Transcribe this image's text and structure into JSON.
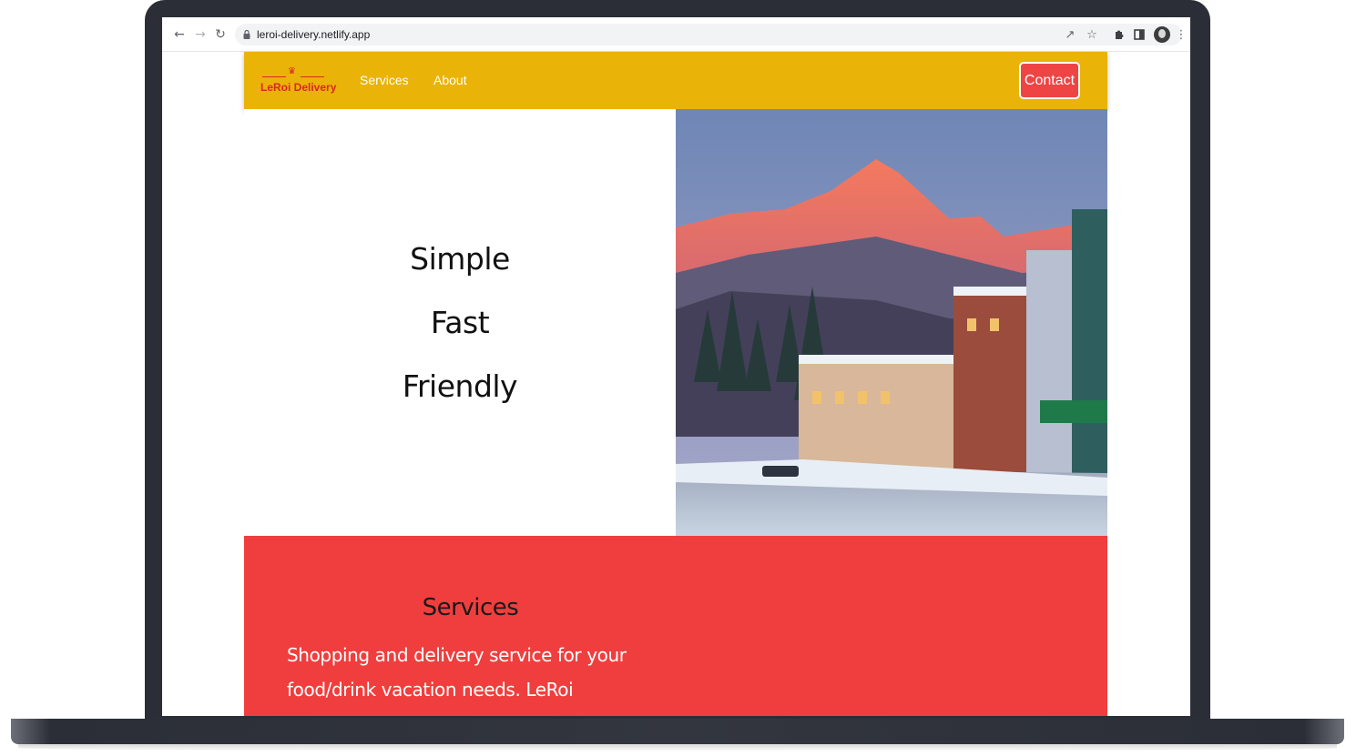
{
  "browser": {
    "url": "leroi-delivery.netlify.app",
    "back_icon": "arrow-left-icon",
    "forward_icon": "arrow-right-icon",
    "reload_icon": "reload-icon",
    "lock_icon": "lock-icon",
    "share_icon": "share-icon",
    "bookmark_icon": "star-icon",
    "extensions_icon": "puzzle-icon",
    "sidepanel_icon": "side-panel-icon",
    "menu_icon": "kebab-menu-icon"
  },
  "site": {
    "logo": {
      "text": "LeRoi Delivery",
      "crown": "♛"
    },
    "nav": {
      "services_label": "Services",
      "about_label": "About",
      "contact_label": "Contact"
    },
    "hero": {
      "word1": "Simple",
      "word2": "Fast",
      "word3": "Friendly"
    },
    "services": {
      "title": "Services",
      "text": "Shopping and delivery service for your food/drink vacation needs. LeRoi Delivery"
    }
  },
  "colors": {
    "nav_bg": "#eab308",
    "contact_bg": "#ef4444",
    "services_bg": "#f03e3e",
    "logo": "#dc2626"
  }
}
